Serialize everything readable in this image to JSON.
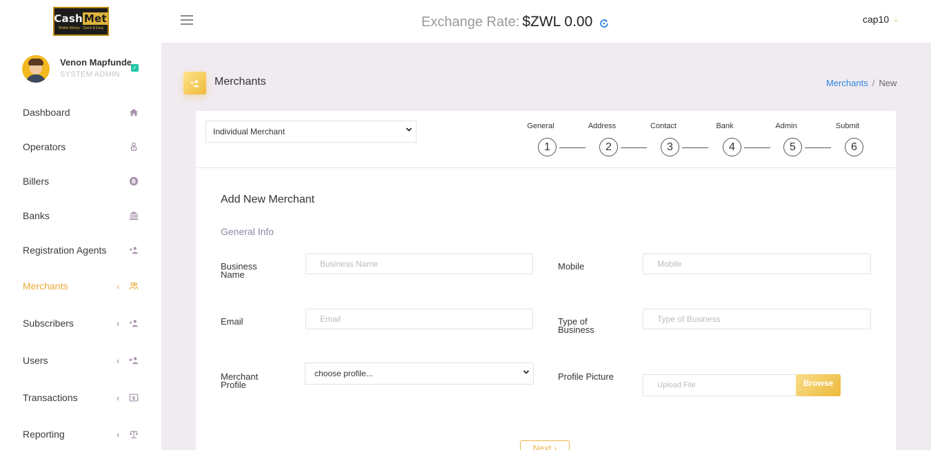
{
  "brand": {
    "logo_text_1": "Cash",
    "logo_text_2": "Met",
    "logo_tagline": "Mobile Money · Quick & Easy"
  },
  "profile": {
    "name": "Venon Mapfunde",
    "role": "SYSTEM ADMIN"
  },
  "sidebar": {
    "items": [
      {
        "label": "Dashboard",
        "icon": "home-icon",
        "has_submenu": false
      },
      {
        "label": "Operators",
        "icon": "operator-icon",
        "has_submenu": false
      },
      {
        "label": "Billers",
        "icon": "bitcoin-icon",
        "has_submenu": false
      },
      {
        "label": "Banks",
        "icon": "bank-icon",
        "has_submenu": false
      },
      {
        "label": "Registration Agents",
        "icon": "user-plus-icon",
        "has_submenu": false
      },
      {
        "label": "Merchants",
        "icon": "users-icon",
        "has_submenu": true,
        "active": true
      },
      {
        "label": "Subscribers",
        "icon": "user-plus-icon",
        "has_submenu": true
      },
      {
        "label": "Users",
        "icon": "user-key-icon",
        "has_submenu": true
      },
      {
        "label": "Transactions",
        "icon": "dollar-bill-icon",
        "has_submenu": true
      },
      {
        "label": "Reporting",
        "icon": "balance-scale-icon",
        "has_submenu": true
      }
    ],
    "chevron": "‹"
  },
  "topbar": {
    "exchange_label": "Exchange Rate:",
    "exchange_value": "$ZWL 0.00",
    "user": "cap10",
    "user_chevron": "⌄"
  },
  "page": {
    "title": "Merchants",
    "breadcrumb": {
      "link": "Merchants",
      "separator": "/",
      "current": "New"
    }
  },
  "merchant_type": {
    "selected": "Individual Merchant"
  },
  "stepper": {
    "steps": [
      {
        "label": "General",
        "number": "1"
      },
      {
        "label": "Address",
        "number": "2"
      },
      {
        "label": "Contact",
        "number": "3"
      },
      {
        "label": "Bank",
        "number": "4"
      },
      {
        "label": "Admin",
        "number": "5"
      },
      {
        "label": "Submit",
        "number": "6"
      }
    ]
  },
  "form": {
    "title": "Add New Merchant",
    "subtitle": "General Info",
    "business_name": {
      "label_1": "Business",
      "label_2": "Name",
      "placeholder": "Business Name"
    },
    "mobile": {
      "label": "Mobile",
      "placeholder": "Mobile"
    },
    "email": {
      "label": "Email",
      "placeholder": "Email"
    },
    "type_of_business": {
      "label_1": "Type of",
      "label_2": "Business",
      "placeholder": "Type of Business"
    },
    "merchant_profile": {
      "label_1": "Merchant",
      "label_2": "Profile",
      "selected": "choose profile..."
    },
    "profile_picture": {
      "label": "Profile Picture",
      "placeholder": "Upload File",
      "browse_label": "Browse"
    },
    "next_label": "Next ›"
  },
  "colors": {
    "accent": "#e9a93a",
    "link": "#2e86de",
    "content_bg": "#f0ebf1",
    "sidebar_icon": "#a892ad"
  }
}
